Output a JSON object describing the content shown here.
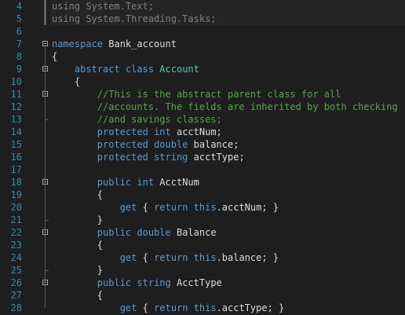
{
  "editor": {
    "lines": [
      {
        "num": "4",
        "segments": [
          {
            "text": "using System.Text;",
            "kind": "dim"
          }
        ]
      },
      {
        "num": "5",
        "segments": [
          {
            "text": "using System.Threading.Tasks;",
            "kind": "dim"
          }
        ]
      },
      {
        "num": "6",
        "segments": []
      },
      {
        "num": "7",
        "fold": true,
        "segments": [
          {
            "text": "namespace",
            "kind": "kw"
          },
          {
            "text": " Bank_account",
            "kind": "tx"
          }
        ]
      },
      {
        "num": "8",
        "segments": [
          {
            "text": "{",
            "kind": "tx"
          }
        ]
      },
      {
        "num": "9",
        "fold": true,
        "segments": [
          {
            "text": "    ",
            "kind": "tx"
          },
          {
            "text": "abstract",
            "kind": "kw"
          },
          {
            "text": " ",
            "kind": "tx"
          },
          {
            "text": "class",
            "kind": "kw"
          },
          {
            "text": " ",
            "kind": "tx"
          },
          {
            "text": "Account",
            "kind": "ty"
          }
        ]
      },
      {
        "num": "10",
        "segments": [
          {
            "text": "    {",
            "kind": "tx"
          }
        ]
      },
      {
        "num": "11",
        "fold": true,
        "segments": [
          {
            "text": "        //This is the abstract parent class for all",
            "kind": "cm"
          }
        ]
      },
      {
        "num": "12",
        "segments": [
          {
            "text": "        //accounts. The fields are inherited by both checking",
            "kind": "cm"
          }
        ]
      },
      {
        "num": "13",
        "segments": [
          {
            "text": "        //and savings classes;",
            "kind": "cm"
          }
        ]
      },
      {
        "num": "14",
        "segments": [
          {
            "text": "        ",
            "kind": "tx"
          },
          {
            "text": "protected",
            "kind": "kw"
          },
          {
            "text": " ",
            "kind": "tx"
          },
          {
            "text": "int",
            "kind": "kw"
          },
          {
            "text": " acctNum;",
            "kind": "tx"
          }
        ]
      },
      {
        "num": "15",
        "segments": [
          {
            "text": "        ",
            "kind": "tx"
          },
          {
            "text": "protected",
            "kind": "kw"
          },
          {
            "text": " ",
            "kind": "tx"
          },
          {
            "text": "double",
            "kind": "kw"
          },
          {
            "text": " balance;",
            "kind": "tx"
          }
        ]
      },
      {
        "num": "16",
        "segments": [
          {
            "text": "        ",
            "kind": "tx"
          },
          {
            "text": "protected",
            "kind": "kw"
          },
          {
            "text": " ",
            "kind": "tx"
          },
          {
            "text": "string",
            "kind": "kw"
          },
          {
            "text": " acctType;",
            "kind": "tx"
          }
        ]
      },
      {
        "num": "17",
        "segments": []
      },
      {
        "num": "18",
        "fold": true,
        "segments": [
          {
            "text": "        ",
            "kind": "tx"
          },
          {
            "text": "public",
            "kind": "kw"
          },
          {
            "text": " ",
            "kind": "tx"
          },
          {
            "text": "int",
            "kind": "kw"
          },
          {
            "text": " AcctNum",
            "kind": "tx"
          }
        ]
      },
      {
        "num": "19",
        "segments": [
          {
            "text": "        {",
            "kind": "tx"
          }
        ]
      },
      {
        "num": "20",
        "segments": [
          {
            "text": "            ",
            "kind": "tx"
          },
          {
            "text": "get",
            "kind": "kw"
          },
          {
            "text": " { ",
            "kind": "tx"
          },
          {
            "text": "return",
            "kind": "kw"
          },
          {
            "text": " ",
            "kind": "tx"
          },
          {
            "text": "this",
            "kind": "kw"
          },
          {
            "text": ".acctNum; }",
            "kind": "tx"
          }
        ]
      },
      {
        "num": "21",
        "segments": [
          {
            "text": "        }",
            "kind": "tx"
          }
        ]
      },
      {
        "num": "22",
        "fold": true,
        "segments": [
          {
            "text": "        ",
            "kind": "tx"
          },
          {
            "text": "public",
            "kind": "kw"
          },
          {
            "text": " ",
            "kind": "tx"
          },
          {
            "text": "double",
            "kind": "kw"
          },
          {
            "text": " Balance",
            "kind": "tx"
          }
        ]
      },
      {
        "num": "23",
        "segments": [
          {
            "text": "        {",
            "kind": "tx"
          }
        ]
      },
      {
        "num": "24",
        "segments": [
          {
            "text": "            ",
            "kind": "tx"
          },
          {
            "text": "get",
            "kind": "kw"
          },
          {
            "text": " { ",
            "kind": "tx"
          },
          {
            "text": "return",
            "kind": "kw"
          },
          {
            "text": " ",
            "kind": "tx"
          },
          {
            "text": "this",
            "kind": "kw"
          },
          {
            "text": ".balance; }",
            "kind": "tx"
          }
        ]
      },
      {
        "num": "25",
        "segments": [
          {
            "text": "        }",
            "kind": "tx"
          }
        ]
      },
      {
        "num": "26",
        "fold": true,
        "segments": [
          {
            "text": "        ",
            "kind": "tx"
          },
          {
            "text": "public",
            "kind": "kw"
          },
          {
            "text": " ",
            "kind": "tx"
          },
          {
            "text": "string",
            "kind": "kw"
          },
          {
            "text": " AcctType",
            "kind": "tx"
          }
        ]
      },
      {
        "num": "27",
        "segments": [
          {
            "text": "        {",
            "kind": "tx"
          }
        ]
      },
      {
        "num": "28",
        "segments": [
          {
            "text": "            ",
            "kind": "tx"
          },
          {
            "text": "get",
            "kind": "kw"
          },
          {
            "text": " { ",
            "kind": "tx"
          },
          {
            "text": "return",
            "kind": "kw"
          },
          {
            "text": " ",
            "kind": "tx"
          },
          {
            "text": "this",
            "kind": "kw"
          },
          {
            "text": ".acctType; }",
            "kind": "tx"
          }
        ]
      }
    ]
  }
}
